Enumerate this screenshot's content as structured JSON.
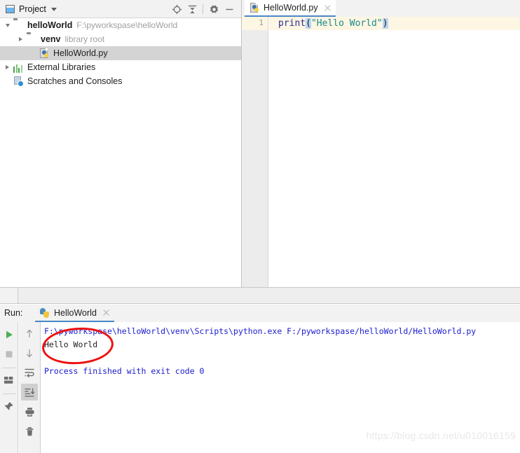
{
  "project_panel": {
    "title": "Project",
    "window_icon": "project-window-icon",
    "actions": [
      {
        "name": "locate-icon",
        "label": ""
      },
      {
        "name": "collapse-all-icon",
        "label": ""
      },
      {
        "name": "settings-gear-icon",
        "label": ""
      },
      {
        "name": "minimize-icon",
        "label": ""
      }
    ],
    "tree": [
      {
        "label": "helloWorld",
        "sublabel": "F:\\pyworkspase\\helloWorld",
        "icon": "folder-icon",
        "twisty": "expanded",
        "indent": 0,
        "bold": true,
        "selected": false
      },
      {
        "label": "venv",
        "sublabel": "library root",
        "icon": "folder-venv-icon",
        "twisty": "collapsed",
        "indent": 1,
        "bold": true,
        "selected": false
      },
      {
        "label": "HelloWorld.py",
        "sublabel": "",
        "icon": "python-file-icon",
        "twisty": "none",
        "indent": 2,
        "bold": false,
        "selected": true
      },
      {
        "label": "External Libraries",
        "sublabel": "",
        "icon": "external-libraries-icon",
        "twisty": "collapsed",
        "indent": 0,
        "bold": false,
        "selected": false
      },
      {
        "label": "Scratches and Consoles",
        "sublabel": "",
        "icon": "scratches-icon",
        "twisty": "none",
        "indent": 0,
        "bold": false,
        "selected": false
      }
    ]
  },
  "editor": {
    "tab": {
      "title": "HelloWorld.py",
      "icon": "python-file-icon",
      "close_icon": "close-icon"
    },
    "line_number": "1",
    "code": {
      "fn": "print",
      "open_paren": "(",
      "string": "\"Hello World\"",
      "close_paren": ")"
    },
    "colors": {
      "function": "#2b2b8f",
      "string": "#1a8a8a",
      "bracket_match_bg": "#b8d6f5",
      "current_line_bg": "#fdf6e3"
    }
  },
  "run_panel": {
    "label": "Run:",
    "tab": {
      "title": "HelloWorld",
      "icon": "python-icon",
      "close_icon": "close-icon"
    },
    "toolbar_left": [
      {
        "name": "run-button",
        "icon": "play-icon",
        "active": false
      },
      {
        "name": "stop-button",
        "icon": "stop-icon",
        "active": false
      },
      {
        "name": "layout-button",
        "icon": "layout-icon",
        "active": false
      },
      {
        "name": "pin-button",
        "icon": "pin-icon",
        "active": false
      }
    ],
    "toolbar_right": [
      {
        "name": "prev-occurrence-button",
        "icon": "arrow-up-icon",
        "active": false
      },
      {
        "name": "next-occurrence-button",
        "icon": "arrow-down-icon",
        "active": false
      },
      {
        "name": "soft-wrap-button",
        "icon": "soft-wrap-icon",
        "active": false
      },
      {
        "name": "scroll-to-end-button",
        "icon": "scroll-to-end-icon",
        "active": true
      },
      {
        "name": "print-button",
        "icon": "printer-icon",
        "active": false
      },
      {
        "name": "clear-all-button",
        "icon": "trash-icon",
        "active": false
      }
    ],
    "console": {
      "command": "F:\\pyworkspase\\helloWorld\\venv\\Scripts\\python.exe F:/pyworkspase/helloWorld/HelloWorld.py",
      "output": "Hello World",
      "blank": "",
      "finished": "Process finished with exit code 0",
      "colors": {
        "command": "#1b1bd0",
        "output": "#1d1d1d",
        "finished": "#1b1bd0"
      }
    },
    "annotation": {
      "name": "red-ellipse-highlight",
      "color": "#ee1111",
      "target": "Hello World"
    }
  },
  "watermark": {
    "text": "https://blog.csdn.net/u010016159"
  }
}
